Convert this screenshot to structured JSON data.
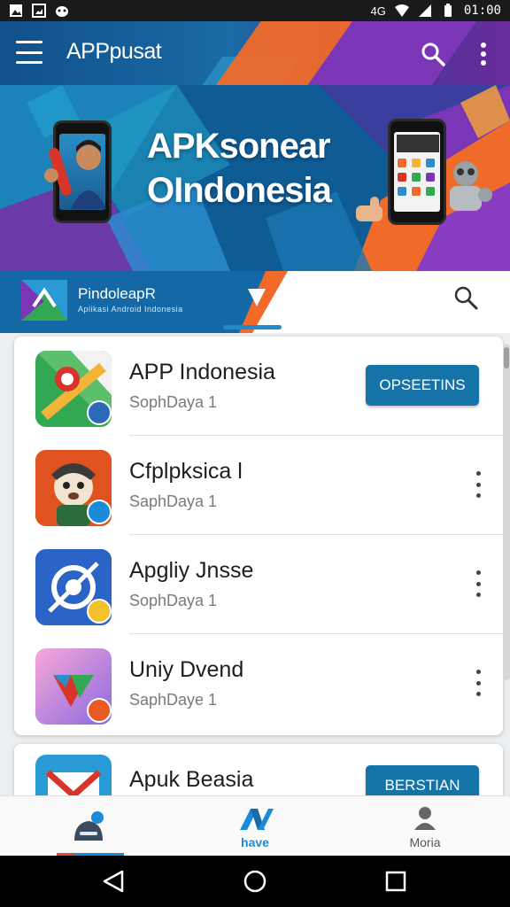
{
  "status_bar": {
    "time": "01:00",
    "network_text": "4G"
  },
  "app_bar": {
    "title": "APPpusat"
  },
  "banner": {
    "title_line1": "APKsonear",
    "title_line2": "OIndonesia"
  },
  "search_strip": {
    "brand_name": "PindoleapR",
    "brand_tagline": "Aplikasi Android Indonesia"
  },
  "apps": [
    {
      "name": "APP Indonesia",
      "developer": "SophDaya 1",
      "action": "OPSEETINS"
    },
    {
      "name": "Cfplpksica l",
      "developer": "SaphDaya 1"
    },
    {
      "name": "Apgliy Jnsse",
      "developer": "SophDaya 1"
    },
    {
      "name": "Uniy Dvend",
      "developer": "SaphDaye 1"
    },
    {
      "name": "Apuk Beasia",
      "action": "BERSTIAN"
    }
  ],
  "bottom_nav": {
    "items": [
      {
        "label": ""
      },
      {
        "label": "have"
      },
      {
        "label": "Moria"
      }
    ]
  },
  "colors": {
    "primary": "#1673a8",
    "accent_orange": "#f06a2a",
    "accent_purple": "#7b36b8",
    "active_tab": "#1a8bd6"
  }
}
